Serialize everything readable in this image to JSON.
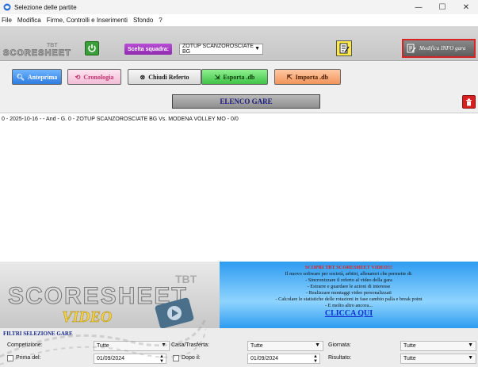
{
  "window": {
    "title": "Selezione delle partite",
    "controls": {
      "minimize": "—",
      "maximize": "☐",
      "close": "✕"
    }
  },
  "menu": [
    "File",
    "Modifica",
    "Firme, Controlli e Inserimenti",
    "Sfondo",
    "?"
  ],
  "toolbar": {
    "logo_text": "SCORESHEET",
    "logo_badge": "TBT",
    "team_label": "Scelta squadra:",
    "team_value": "ZOTUP SCANZOROSCIATE BG",
    "info_button": "Modifica INFO gara"
  },
  "actions": {
    "preview": "Anteprima",
    "history": "Cronologia",
    "close_report": "Chiudi Referto",
    "export": "Esporta .db",
    "import": "Importa .db"
  },
  "list": {
    "header": "ELENCO GARE",
    "rows": [
      "0 - 2025-10-16 -  - And - G. 0 - ZOTUP SCANZOROSCIATE BG Vs. MODENA VOLLEY MO - 0/0"
    ]
  },
  "promo": {
    "logo_text": "SCORESHEET",
    "logo_badge": "TBT",
    "video_text": "VIDEO",
    "title": "SCOPRI TBT SCORESHEET VIDEO!!!",
    "lines": [
      "Il nuovo software per società, arbitri, allenatori che permette di:",
      "- Sincronizzare il referto al video della gara",
      "- Estrarre e guardare le azioni di interesse",
      "- Realizzare montaggi video personalizzati",
      "- Calcolare le statistiche delle rotazioni in fase cambio palla e break point",
      "- E molto altro ancora..."
    ],
    "link": "CLICCA QUI"
  },
  "filters": {
    "title": "FILTRI SELEZIONE GARE",
    "competizione_label": "Competizione:",
    "competizione_value": "Tutte",
    "casa_label": "Casa/Trasferta:",
    "casa_value": "Tutte",
    "giornata_label": "Giornata:",
    "giornata_value": "Tutte",
    "prima_label": "Prima del:",
    "prima_value": "01/09/2024",
    "dopo_label": "Dopo il:",
    "dopo_value": "01/09/2024",
    "risultato_label": "Risultato:",
    "risultato_value": "Tutte"
  },
  "colors": {
    "accent_red": "#d62424",
    "team_label_bg": "#9b35bd",
    "link_blue": "#0f2fcf"
  }
}
